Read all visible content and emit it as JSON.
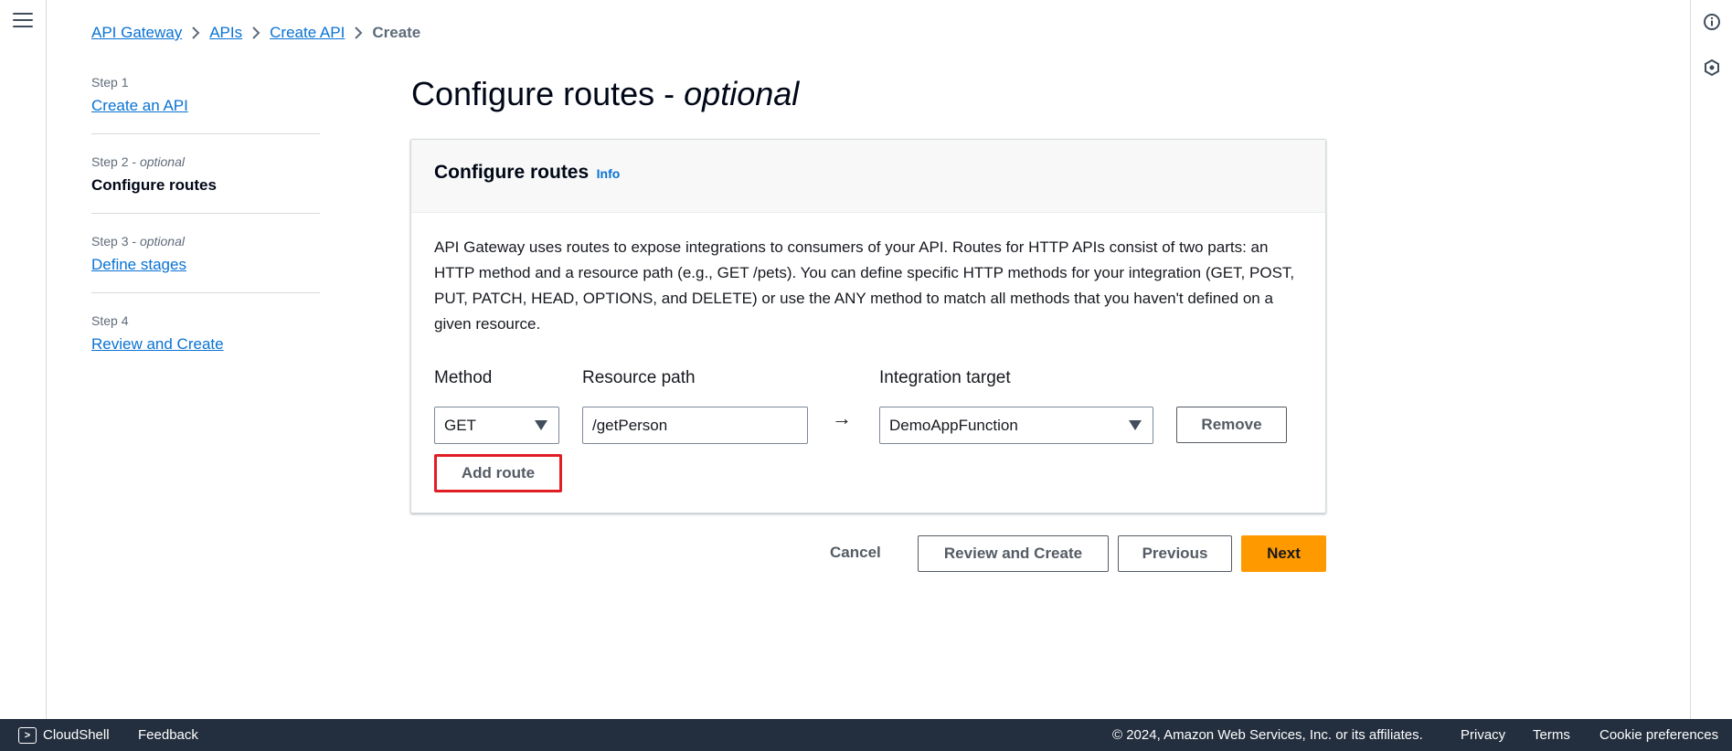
{
  "breadcrumb": {
    "items": [
      "API Gateway",
      "APIs",
      "Create API"
    ],
    "current": "Create"
  },
  "steps": [
    {
      "number": "Step 1",
      "optional": "",
      "label": "Create an API",
      "state": "link"
    },
    {
      "number": "Step 2",
      "optional": "optional",
      "label": "Configure routes",
      "state": "current"
    },
    {
      "number": "Step 3",
      "optional": "optional",
      "label": "Define stages",
      "state": "link"
    },
    {
      "number": "Step 4",
      "optional": "",
      "label": "Review and Create",
      "state": "link"
    }
  ],
  "page": {
    "title": "Configure routes - ",
    "title_optional": "optional"
  },
  "card": {
    "title": "Configure routes",
    "info": "Info",
    "description": "API Gateway uses routes to expose integrations to consumers of your API. Routes for HTTP APIs consist of two parts: an HTTP method and a resource path (e.g., GET /pets). You can define specific HTTP methods for your integration (GET, POST, PUT, PATCH, HEAD, OPTIONS, and DELETE) or use the ANY method to match all methods that you haven't defined on a given resource.",
    "labels": {
      "method": "Method",
      "resource_path": "Resource path",
      "integration_target": "Integration target"
    },
    "route": {
      "method": "GET",
      "resource_path": "/getPerson",
      "integration_target": "DemoAppFunction",
      "arrow": "→"
    },
    "remove_label": "Remove",
    "add_route_label": "Add route"
  },
  "actions": {
    "cancel": "Cancel",
    "review": "Review and Create",
    "previous": "Previous",
    "next": "Next"
  },
  "footer": {
    "cloudshell": "CloudShell",
    "feedback": "Feedback",
    "copyright": "© 2024, Amazon Web Services, Inc. or its affiliates.",
    "privacy": "Privacy",
    "terms": "Terms",
    "cookies": "Cookie preferences"
  },
  "colors": {
    "link": "#0972d3",
    "primary": "#ff9900",
    "highlight": "#e01e24",
    "footer_bg": "#232f3e"
  }
}
